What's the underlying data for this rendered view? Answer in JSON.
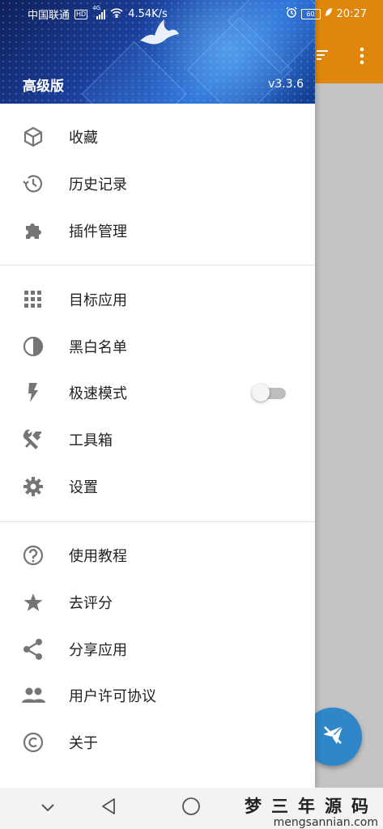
{
  "status_bar": {
    "carrier": "中国联通",
    "hd_badge": "HD",
    "network": "4G",
    "speed": "4.54K/s",
    "battery": "60",
    "time": "20:27"
  },
  "drawer": {
    "title": "高级版",
    "version": "v3.3.6",
    "sections": [
      [
        {
          "label": "收藏",
          "icon": "cube-icon"
        },
        {
          "label": "历史记录",
          "icon": "history-icon"
        },
        {
          "label": "插件管理",
          "icon": "puzzle-icon"
        }
      ],
      [
        {
          "label": "目标应用",
          "icon": "apps-grid-icon"
        },
        {
          "label": "黑白名单",
          "icon": "contrast-icon"
        },
        {
          "label": "极速模式",
          "icon": "flash-icon",
          "toggle": false
        },
        {
          "label": "工具箱",
          "icon": "tools-icon"
        },
        {
          "label": "设置",
          "icon": "gear-icon"
        }
      ],
      [
        {
          "label": "使用教程",
          "icon": "help-icon"
        },
        {
          "label": "去评分",
          "icon": "star-icon"
        },
        {
          "label": "分享应用",
          "icon": "share-icon"
        },
        {
          "label": "用户许可协议",
          "icon": "people-icon"
        },
        {
          "label": "关于",
          "icon": "copyright-icon"
        }
      ]
    ]
  },
  "watermark": {
    "cn": "梦三年源码",
    "en": "mengsannian.com"
  },
  "colors": {
    "accent_orange": "#e0870b",
    "fab_blue": "#2f86c8",
    "icon_gray": "#757575"
  }
}
